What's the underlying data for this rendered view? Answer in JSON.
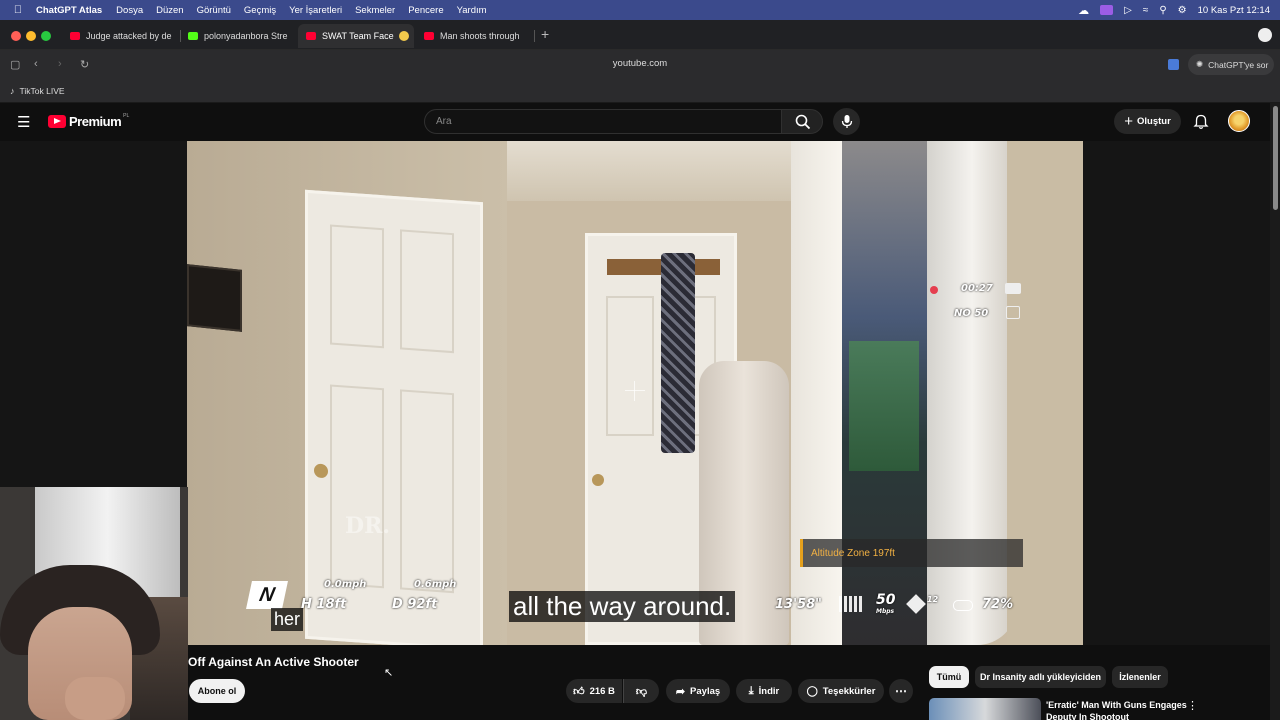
{
  "menubar": {
    "app_name": "ChatGPT Atlas",
    "items": [
      "Dosya",
      "Düzen",
      "Görüntü",
      "Geçmiş",
      "Yer İşaretleri",
      "Sekmeler",
      "Pencere",
      "Yardım"
    ],
    "clock": "10 Kas Pzt  12:14"
  },
  "tabs": [
    {
      "title": "Judge attacked by de",
      "icon": "youtube-icon"
    },
    {
      "title": "polonyadanbora Stre",
      "icon": "kick-icon"
    },
    {
      "title": "SWAT Team Face",
      "icon": "youtube-icon"
    },
    {
      "title": "Man shoots through",
      "icon": "youtube-icon"
    }
  ],
  "address": {
    "url": "youtube.com",
    "ask_label": "ChatGPT'ye sor"
  },
  "bookmarks": [
    {
      "label": "TikTok LIVE",
      "icon": "tiktok-icon"
    }
  ],
  "youtube": {
    "logo_text": "Premium",
    "logo_badge": "PL",
    "search_placeholder": "Ara",
    "create_label": "Oluştur"
  },
  "video": {
    "hud": {
      "speed_h": "0.0mph",
      "speed_v": "0.6mph",
      "height": "H 18ft",
      "distance": "D 92ft",
      "compass": "N",
      "rec_time": "00:27",
      "noise": "NO 50",
      "flight_time": "13'58\"",
      "bitrate": "50",
      "bitrate_unit": "Mbps",
      "sat_count": "12",
      "battery": "72%",
      "altitude_zone": "Altitude Zone 197ft",
      "watermark": "DR."
    },
    "caption_main": "all the way around.",
    "caption_small": "her"
  },
  "details": {
    "title": "Off Against An Active Shooter",
    "subscribe_label": "Abone ol",
    "like_count": "216 B",
    "share_label": "Paylaş",
    "download_label": "İndir",
    "thanks_label": "Teşekkürler"
  },
  "chips": [
    "Tümü",
    "Dr Insanity adlı yükleyiciden",
    "İzlenenler"
  ],
  "related": [
    {
      "title_line1": "'Erratic' Man With Guns Engages",
      "title_line2": "Deputy In Shootout"
    }
  ]
}
